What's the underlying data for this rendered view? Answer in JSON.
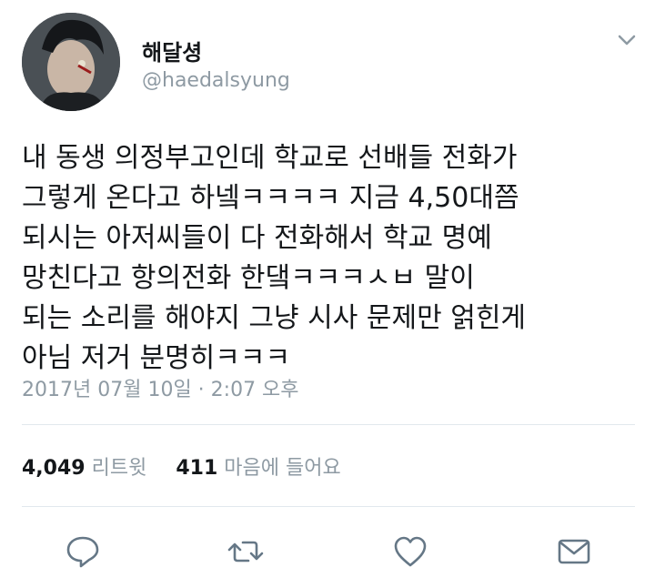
{
  "user": {
    "display_name": "해달셩",
    "handle": "@haedalsyung",
    "avatar_icon": "profile-avatar"
  },
  "tweet": {
    "lines": [
      "내 동생 의정부고인데 학교로 선배들 전화가",
      "그렇게 온다고 하넼ㅋㅋㅋㅋ 지금 4,50대쯤",
      "되시는 아저씨들이 다 전화해서 학교 명예",
      "망친다고 항의전화 한댘ㅋㅋㅋㅅㅂ 말이",
      "되는 소리를 해야지 그냥 시사 문제만 얽힌게",
      "아님 저거 분명히ㅋㅋㅋ"
    ],
    "timestamp": "2017년 07월 10일 · 2:07 오후"
  },
  "stats": {
    "retweets_count": "4,049",
    "retweets_label": "리트윗",
    "likes_count": "411",
    "likes_label": "마음에 들어요"
  },
  "actions": [
    "reply-icon",
    "retweet-icon",
    "like-icon",
    "share-icon"
  ],
  "colors": {
    "text": "#14171a",
    "secondary": "#8e9aa3",
    "divider": "#e1e8ed",
    "icon": "#657786"
  }
}
